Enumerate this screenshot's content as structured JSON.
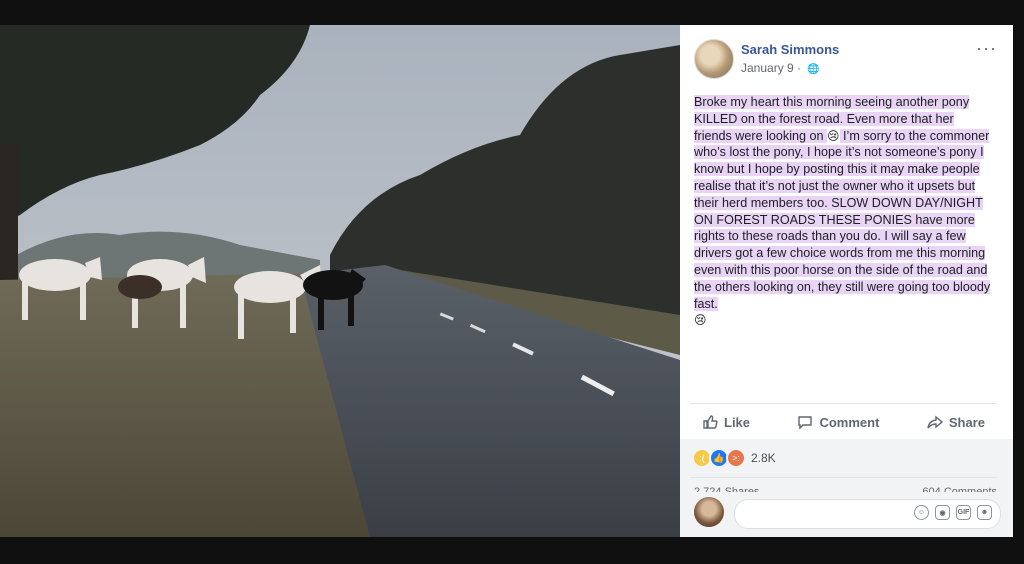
{
  "post": {
    "author": "Sarah Simmons",
    "date": "January 9",
    "date_separator": "·",
    "privacy_icon": "globe-icon",
    "more_label": "···",
    "text_parts": [
      "Broke my heart this morning seeing another pony KILLED on the forest road. Even more that her friends were looking on ",
      " I’m sorry to the commoner who’s lost the pony, I hope it’s not someone’s pony I know but I hope by posting this it may make people realise that it’s not just the owner who it upsets but their herd members too. SLOW DOWN DAY/NIGHT ON FOREST ROADS THESE PONIES have more rights to these roads than you do. I will say a few drivers got a few choice words from me this morning even with this poor horse on the side of the road and the others looking on, they still were going too bloody fast."
    ],
    "emoji_1": "😢",
    "emoji_2": "😢"
  },
  "actions": {
    "like": "Like",
    "comment": "Comment",
    "share": "Share"
  },
  "reactions": {
    "icons": [
      "sad-face-icon",
      "like-thumb-icon",
      "angry-face-icon"
    ],
    "count": "2.8K"
  },
  "counts": {
    "shares": "2,724 Shares",
    "comments": "604 Comments"
  },
  "composer": {
    "placeholder": "",
    "icons": [
      "emoji-icon",
      "camera-icon",
      "gif-icon",
      "sticker-icon"
    ],
    "gif_label": "GIF"
  },
  "colors": {
    "author_link": "#385898",
    "highlight": "#e9d4f6",
    "background": "#0f0f10"
  }
}
